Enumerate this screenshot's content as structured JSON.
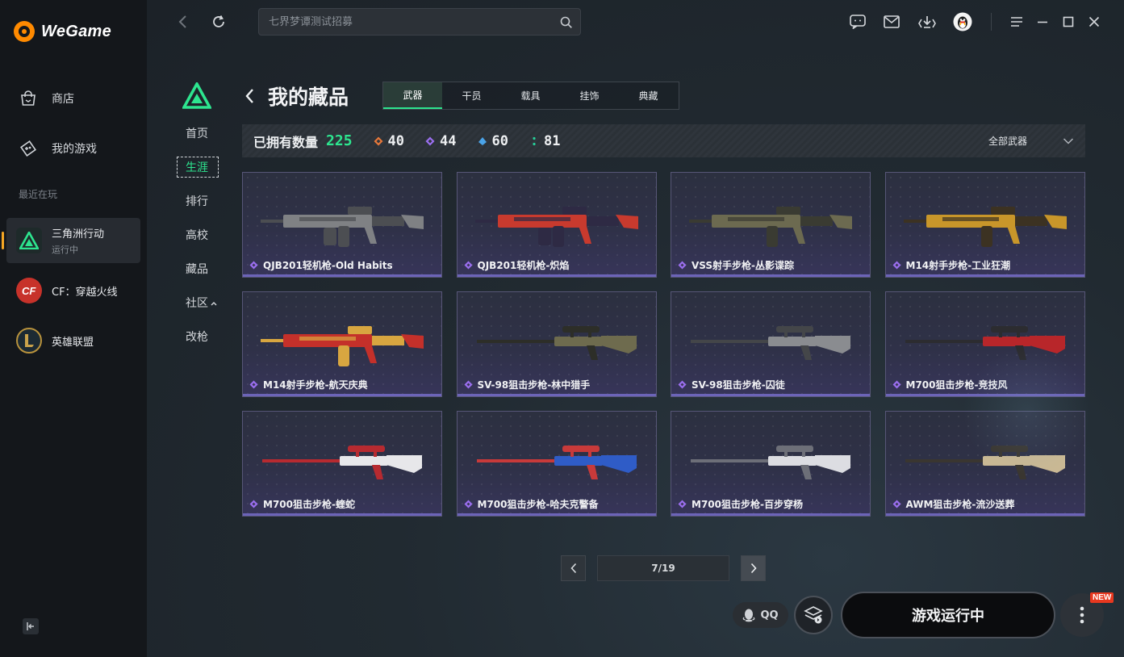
{
  "app": {
    "brand": "WeGame"
  },
  "sidebar": {
    "nav": [
      {
        "label": "商店",
        "icon": "store-bag-icon"
      },
      {
        "label": "我的游戏",
        "icon": "gamepad-icon"
      }
    ],
    "recent_label": "最近在玩",
    "recent_games": [
      {
        "name": "三角洲行动",
        "status": "运行中",
        "icon": "delta-force-icon",
        "active": true
      },
      {
        "name": "CF：穿越火线",
        "status": "",
        "icon": "crossfire-icon",
        "active": false
      },
      {
        "name": "英雄联盟",
        "status": "",
        "icon": "league-of-legends-icon",
        "active": false
      }
    ]
  },
  "topbar": {
    "search_placeholder": "七界梦谭测试招募"
  },
  "game_nav": [
    "首页",
    "生涯",
    "排行",
    "高校",
    "藏品",
    "社区",
    "改枪"
  ],
  "game_nav_active": 1,
  "page": {
    "title": "我的藏品",
    "tabs": [
      "武器",
      "干员",
      "载具",
      "挂饰",
      "典藏"
    ],
    "active_tab": 0
  },
  "stats": {
    "owned_label": "已拥有数量",
    "owned_count": "225",
    "rarities": [
      {
        "count": "40",
        "color": "#e8783a"
      },
      {
        "count": "44",
        "color": "#9b6ff0"
      },
      {
        "count": "60",
        "color": "#4aa3e8"
      },
      {
        "count": "81",
        "color": "#27d19a"
      }
    ],
    "filter_label": "全部武器"
  },
  "items": [
    {
      "name": "QJB201轻机枪-Old Habits",
      "palette": [
        "#7f8184",
        "#4c4e52"
      ]
    },
    {
      "name": "QJB201轻机枪-炽焰",
      "palette": [
        "#c83a2e",
        "#2e2a44"
      ]
    },
    {
      "name": "VSS射手步枪-丛影谍踪",
      "palette": [
        "#6c6a50",
        "#3a3b32"
      ]
    },
    {
      "name": "M14射手步枪-工业狂潮",
      "palette": [
        "#c8962a",
        "#3c3222"
      ]
    },
    {
      "name": "M14射手步枪-航天庆典",
      "palette": [
        "#c4302a",
        "#d8a640"
      ]
    },
    {
      "name": "SV-98狙击步枪-林中猎手",
      "palette": [
        "#6e6b4e",
        "#2d2e28"
      ]
    },
    {
      "name": "SV-98狙击步枪-囚徒",
      "palette": [
        "#8a8c90",
        "#444649"
      ]
    },
    {
      "name": "M700狙击步枪-竞技风",
      "palette": [
        "#b8262a",
        "#2c2c30"
      ]
    },
    {
      "name": "M700狙击步枪-蝰蛇",
      "palette": [
        "#e7e7ea",
        "#b72a30"
      ]
    },
    {
      "name": "M700狙击步枪-哈夫克警备",
      "palette": [
        "#2f5cc7",
        "#c83a3a"
      ]
    },
    {
      "name": "M700狙击步枪-百步穿杨",
      "palette": [
        "#dcdde2",
        "#6d6f78"
      ]
    },
    {
      "name": "AWM狙击步枪-流沙送葬",
      "palette": [
        "#c9b894",
        "#3a3630"
      ]
    }
  ],
  "pagination": {
    "display": "7/19"
  },
  "bottom": {
    "qq_label": "QQ",
    "launch_label": "游戏运行中",
    "new_badge": "NEW"
  }
}
